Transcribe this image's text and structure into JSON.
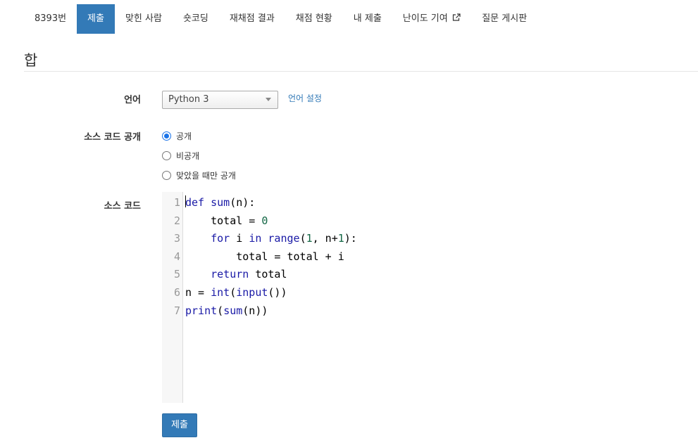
{
  "tabs": [
    {
      "label": "8393번",
      "active": false
    },
    {
      "label": "제출",
      "active": true
    },
    {
      "label": "맞힌 사람",
      "active": false
    },
    {
      "label": "숏코딩",
      "active": false
    },
    {
      "label": "재채점 결과",
      "active": false
    },
    {
      "label": "채점 현황",
      "active": false
    },
    {
      "label": "내 제출",
      "active": false
    },
    {
      "label": "난이도 기여",
      "active": false,
      "icon": "external-link-icon"
    },
    {
      "label": "질문 게시판",
      "active": false
    }
  ],
  "title": "합",
  "form": {
    "language_label": "언어",
    "language_value": "Python 3",
    "language_settings_link": "언어 설정",
    "visibility_label": "소스 코드 공개",
    "visibility_options": [
      {
        "label": "공개",
        "checked": true
      },
      {
        "label": "비공개",
        "checked": false
      },
      {
        "label": "맞았을 때만 공개",
        "checked": false
      }
    ],
    "code_label": "소스 코드",
    "submit_label": "제출"
  },
  "code_lines": [
    {
      "num": "1",
      "text": "def sum(n):"
    },
    {
      "num": "2",
      "text": "    total = 0"
    },
    {
      "num": "3",
      "text": "    for i in range(1, n+1):"
    },
    {
      "num": "4",
      "text": "        total = total + i"
    },
    {
      "num": "5",
      "text": "    return total"
    },
    {
      "num": "6",
      "text": "n = int(input())"
    },
    {
      "num": "7",
      "text": "print(sum(n))"
    }
  ],
  "colors": {
    "primary": "#337ab7",
    "keyword": "#1a1aa6",
    "number": "#116644"
  }
}
